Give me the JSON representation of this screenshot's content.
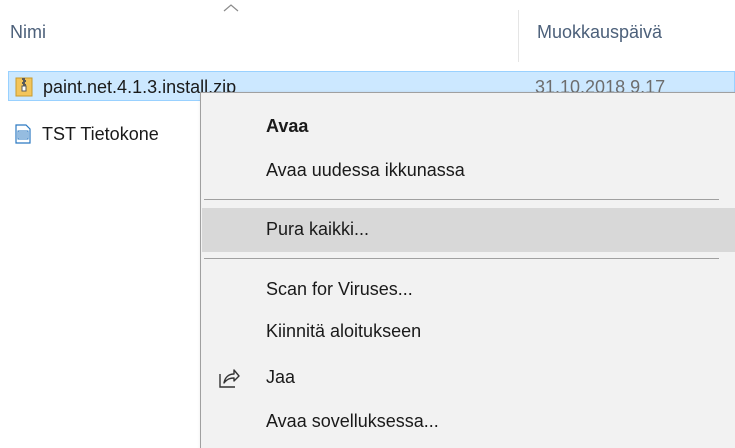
{
  "columns": {
    "name": "Nimi",
    "modified": "Muokkauspäivä"
  },
  "files": [
    {
      "name": "paint.net.4.1.3.install.zip",
      "date": "31.10.2018 9.17",
      "icon": "zip-folder-icon",
      "selected": true
    },
    {
      "name": "TST Tietokone",
      "date": "",
      "icon": "document-icon",
      "selected": false
    }
  ],
  "context_menu": {
    "open": "Avaa",
    "open_new_window": "Avaa uudessa ikkunassa",
    "extract_all": "Pura kaikki...",
    "scan_viruses": "Scan for Viruses...",
    "pin_start": "Kiinnitä aloitukseen",
    "share": "Jaa",
    "open_with": "Avaa sovelluksessa..."
  },
  "colors": {
    "selection_bg": "#cce8ff",
    "selection_border": "#99d1ff",
    "menu_bg": "#f2f2f2",
    "menu_hover": "#d8d8d8",
    "header_text": "#4c607a"
  },
  "icons": {
    "sort": "sort-up-chevron-icon",
    "share": "share-icon"
  }
}
